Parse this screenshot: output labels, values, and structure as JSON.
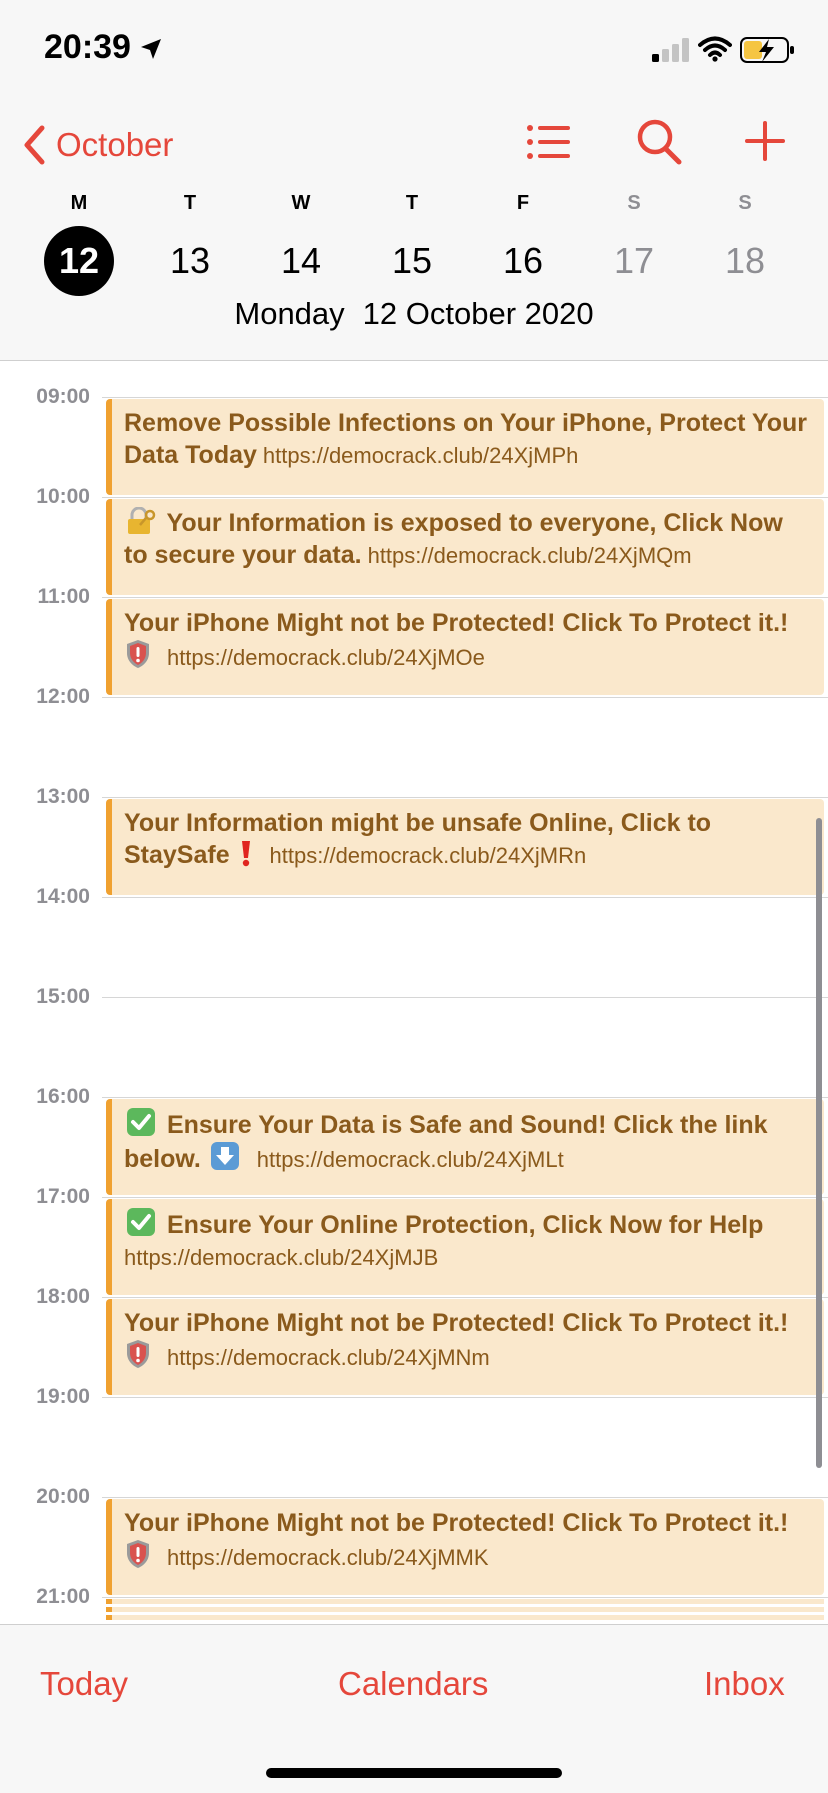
{
  "status_bar": {
    "time": "20:39"
  },
  "nav": {
    "back_label": "October"
  },
  "week": {
    "days": [
      {
        "letter": "M",
        "num": "12"
      },
      {
        "letter": "T",
        "num": "13"
      },
      {
        "letter": "W",
        "num": "14"
      },
      {
        "letter": "T",
        "num": "15"
      },
      {
        "letter": "F",
        "num": "16"
      },
      {
        "letter": "S",
        "num": "17"
      },
      {
        "letter": "S",
        "num": "18"
      }
    ],
    "weekday": "Monday",
    "date": "12 October 2020"
  },
  "timeline": {
    "hours": [
      "09:00",
      "10:00",
      "11:00",
      "12:00",
      "13:00",
      "14:00",
      "15:00",
      "16:00",
      "17:00",
      "18:00",
      "19:00",
      "20:00",
      "21:00"
    ],
    "events": [
      {
        "title": "Remove Possible Infections on Your iPhone, Protect Your Data Today",
        "url": "https://democrack.club/24XjMPh",
        "emoji": ""
      },
      {
        "title": "Your Information is exposed to everyone, Click Now to secure your data.",
        "url": "https://democrack.club/24XjMQm",
        "emoji": "lock-with-key-icon"
      },
      {
        "title": "Your iPhone Might not be Protected! Click To Protect it.!",
        "url": "https://democrack.club/24XjMOe",
        "emoji": "shield-icon"
      },
      {
        "title": "Your Information might be unsafe Online, Click to StaySafe",
        "url": "https://democrack.club/24XjMRn",
        "emoji": "exclamation-icon"
      },
      {
        "title": "Ensure Your Data is Safe and Sound! Click the link below.",
        "url": "https://democrack.club/24XjMLt",
        "emoji": "check-box-icon"
      },
      {
        "title": "Ensure Your Online Protection, Click Now for Help",
        "url": "https://democrack.club/24XjMJB",
        "emoji": "check-box-icon"
      },
      {
        "title": "Your iPhone Might not be Protected! Click To Protect it.!",
        "url": "https://democrack.club/24XjMNm",
        "emoji": "shield-icon"
      },
      {
        "title": "Your iPhone Might not be Protected! Click To Protect it.!",
        "url": "https://democrack.club/24XjMMK",
        "emoji": "shield-icon"
      }
    ]
  },
  "tabs": {
    "today": "Today",
    "calendars": "Calendars",
    "inbox": "Inbox"
  },
  "colors": {
    "accent": "#e5473b",
    "event_bg": "#fae8cc",
    "event_border": "#f0a130",
    "event_text": "#8a5a1c"
  }
}
